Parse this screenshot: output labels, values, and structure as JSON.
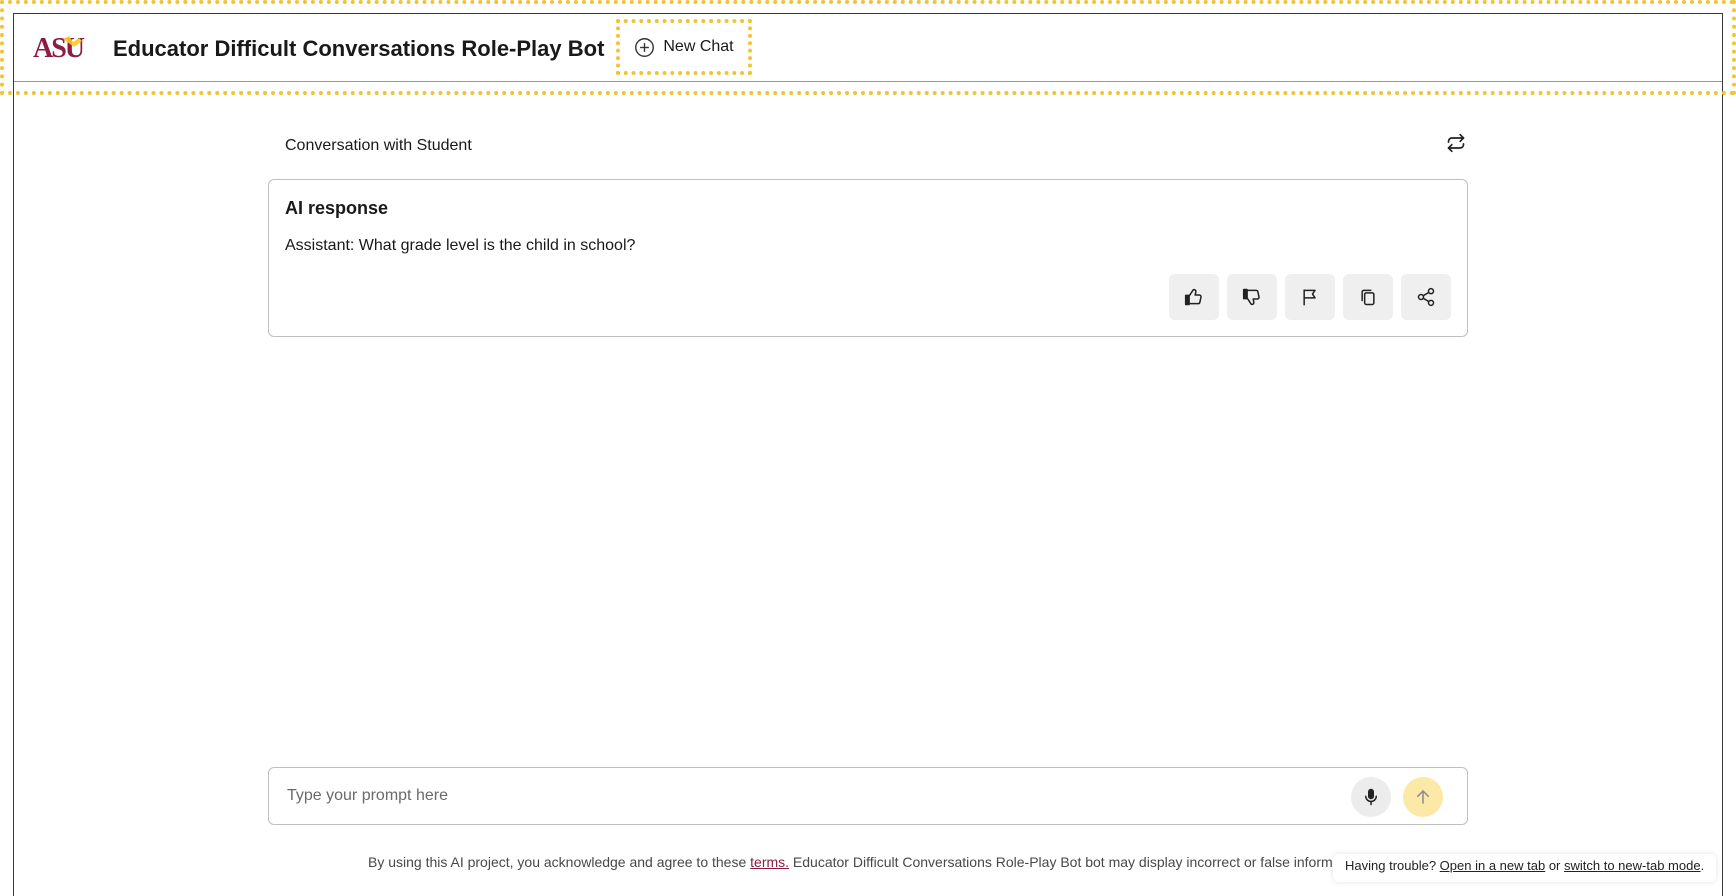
{
  "header": {
    "logo_text": "ASU",
    "title": "Educator Difficult Conversations Role-Play Bot",
    "new_chat_label": "New Chat",
    "brand_maroon": "#8c1d40",
    "brand_gold": "#ffc627"
  },
  "conversation": {
    "title": "Conversation with Student",
    "refresh_icon": "refresh-icon"
  },
  "ai_card": {
    "label": "AI response",
    "message": "Assistant: What grade level is the child in school?",
    "actions": [
      {
        "name": "thumbs-up-icon"
      },
      {
        "name": "thumbs-down-icon"
      },
      {
        "name": "flag-icon"
      },
      {
        "name": "copy-icon"
      },
      {
        "name": "share-icon"
      }
    ]
  },
  "prompt": {
    "placeholder": "Type your prompt here",
    "mic_icon": "microphone-icon",
    "send_icon": "arrow-up-icon"
  },
  "footer": {
    "disclaimer_before": "By using this AI project, you acknowledge and agree to these ",
    "terms_link": "terms.",
    "disclaimer_after": " Educator Difficult Conversations Role-Play Bot bot may display incorrect or false inform",
    "trouble_text": "Having trouble? ",
    "open_new_tab": "Open in a new tab",
    "or_text": " or ",
    "switch_mode": "switch to new-tab mode",
    "period": "."
  }
}
